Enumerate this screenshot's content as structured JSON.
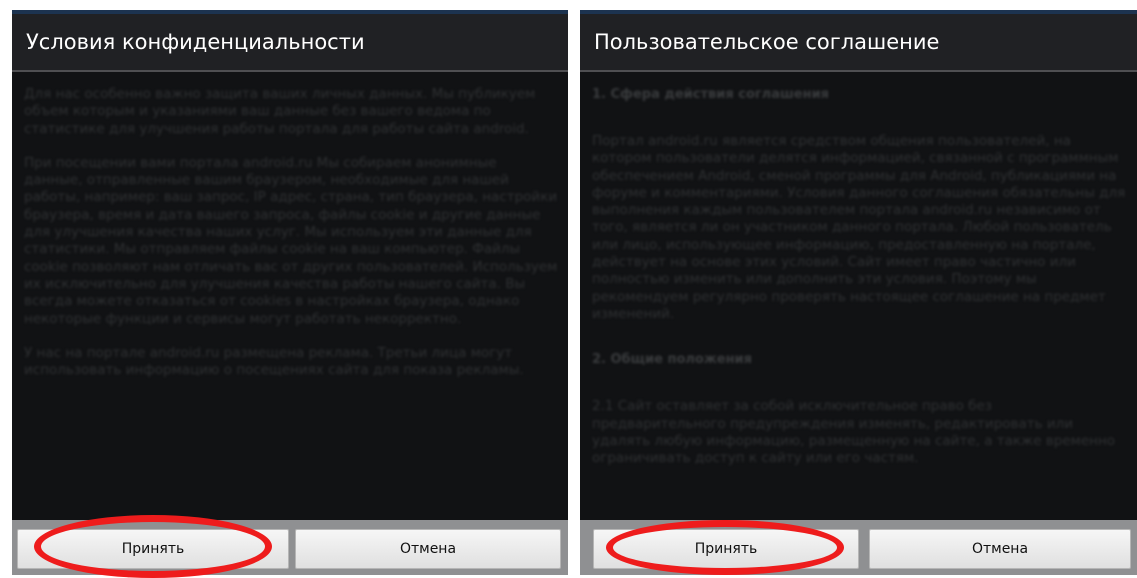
{
  "left_dialog": {
    "title": "Условия конфиденциальности",
    "paragraphs": [
      "Для нас особенно важно защита ваших личных данных. Мы публикуем объем которым и указаниями ваш данные без вашего ведома по статистике для улучшения работы портала для работы сайта android.",
      "При посещении вами портала android.ru Мы собираем анонимные данные, отправленные вашим браузером, необходимые для нашей работы, например: ваш запрос, IP адрес, страна, тип браузера, настройки браузера, время и дата вашего запроса, файлы cookie и другие данные для улучшения качества наших услуг. Мы используем эти данные для статистики. Мы отправляем файлы cookie на ваш компьютер. Файлы cookie позволяют нам отличать вас от других пользователей. Используем их исключительно для улучшения качества работы нашего сайта. Вы всегда можете отказаться от cookies в настройках браузера, однако некоторые функции и сервисы могут работать некорректно.",
      "У нас на портале android.ru размещена реклама. Третьи лица могут использовать информацию о посещениях сайта для показа рекламы."
    ],
    "accept_label": "Принять",
    "cancel_label": "Отмена"
  },
  "right_dialog": {
    "title": "Пользовательское соглашение",
    "sections": [
      {
        "heading": "1. Сфера действия соглашения",
        "paragraphs": [
          "Портал android.ru является средством общения пользователей, на котором пользователи делятся информацией, связанной с программным обеспечением Android, сменой программы для Android, публикациями на форуме и комментариями. Условия данного соглашения обязательны для выполнения каждым пользователем портала android.ru независимо от того, является ли он участником данного портала. Любой пользователь или лицо, использующее информацию, предоставленную на портале, действует на основе этих условий. Сайт имеет право частично или полностью изменить или дополнить эти условия. Поэтому мы рекомендуем регулярно проверять настоящее соглашение на предмет изменений."
        ]
      },
      {
        "heading": "2. Общие положения",
        "paragraphs": [
          "2.1 Сайт оставляет за собой исключительное право без предварительного предупреждения изменять, редактировать или удалять любую информацию, размещенную на сайте, а также временно ограничивать доступ к сайту или его частям."
        ]
      }
    ],
    "accept_label": "Принять",
    "cancel_label": "Отмена"
  },
  "annotation_color": "#ee1c1c"
}
